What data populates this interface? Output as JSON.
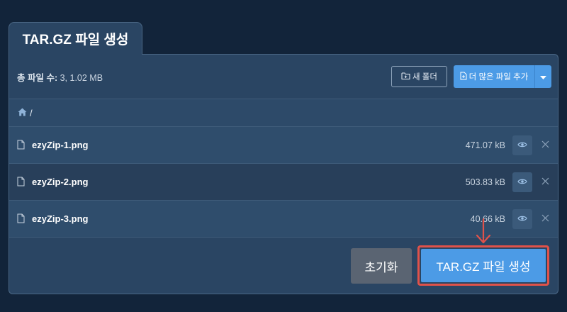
{
  "tab": {
    "title": "TAR.GZ 파일 생성"
  },
  "summary": {
    "label": "총 파일 수:",
    "value": "3, 1.02 MB"
  },
  "toolbar": {
    "new_folder_label": "새 폴더",
    "add_more_label": "더 많은 파일 추가"
  },
  "path": {
    "root": "/"
  },
  "files": [
    {
      "name": "ezyZip-1.png",
      "size": "471.07 kB"
    },
    {
      "name": "ezyZip-2.png",
      "size": "503.83 kB"
    },
    {
      "name": "ezyZip-3.png",
      "size": "40.66 kB"
    }
  ],
  "footer": {
    "reset_label": "초기화",
    "create_label": "TAR.GZ 파일 생성"
  },
  "icons": {
    "folder": "folder-plus-icon",
    "file_add": "file-plus-icon",
    "home": "home-icon",
    "file": "file-icon",
    "view": "eye-icon",
    "remove": "close-icon",
    "caret": "caret-down-icon",
    "annotation": "arrow-down-icon"
  },
  "colors": {
    "primary": "#4c9be6",
    "background": "#12243a",
    "panel": "#2a4563",
    "highlight": "#e0524a",
    "reset": "#5a6472"
  }
}
